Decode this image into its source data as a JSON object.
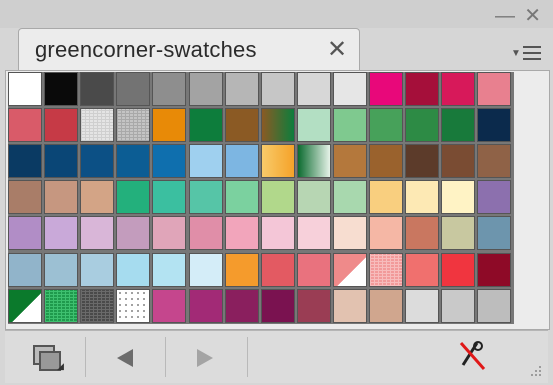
{
  "window": {
    "minimize_icon": "minimize-icon",
    "close_icon": "close-window-icon"
  },
  "tab": {
    "label": "greencorner-swatches",
    "close_glyph": "✕"
  },
  "panel_menu_icon": "panel-menu-icon",
  "swatches": [
    [
      "#ffffff",
      "#0a0a0a",
      "#4a4a4a",
      "#737373",
      "#8e8e8e",
      "#a3a3a3",
      "#b6b6b6",
      "#c6c6c6",
      "#d7d7d7",
      "#e6e6e6",
      "#e8087a",
      "#a50f3a",
      "#d7195a",
      "#e8808f"
    ],
    [
      "#d95b69",
      "#c63a46",
      "pattern:noise-light",
      "pattern:noise-grey",
      "#e88a07",
      "#0d7d3c",
      "#8b5a24",
      "gradient:#8b5a24-#0d7d3c",
      "#b3dfc3",
      "#7fc98f",
      "#47a15a",
      "#2d8b45",
      "#187a3b",
      "#0b2a4c"
    ],
    [
      "#0a3a63",
      "#0a4676",
      "#0c5085",
      "#0c5d94",
      "#0f6fae",
      "#9fd0ef",
      "#7db6e2",
      "gradient:#f8cb6a-#f5a229",
      "gradient:#0c6b30-#e6f2e8",
      "#b4783c",
      "#9a622d",
      "#5c3b2a",
      "#7a4c33",
      "#8f6247"
    ],
    [
      "#a97d68",
      "#c69780",
      "#d3a486",
      "#23b07c",
      "#3bbfa0",
      "#56c5a7",
      "#7bd19f",
      "#b1d88b",
      "#b7d6b3",
      "#a8d8ae",
      "#f9cf7f",
      "#fde9b4",
      "#fff3c5",
      "#8c70ae"
    ],
    [
      "#b18dc6",
      "#c9a9d9",
      "#d9b6d8",
      "#c39cbd",
      "#e0a5b9",
      "#e08ea8",
      "#f2a5bb",
      "#f4c6d7",
      "#f7d0da",
      "#f7ddd0",
      "#f5b7a5",
      "#c97760",
      "#c8c8a0",
      "#6d95ad"
    ],
    [
      "#91b4ca",
      "#9cc0d3",
      "#a9cde0",
      "#a6dcef",
      "#b3e3f2",
      "#d4edf8",
      "#f59b2c",
      "#e35a62",
      "#e9727e",
      "split:#ef8a8a",
      "pattern:noise-pink",
      "#f0706e",
      "#f0353f",
      "#8d1010"
    ],
    [
      "split:#0b7a2c",
      "pattern:noise-green",
      "pattern:noise-dark",
      "pattern:dots",
      "#c5468d",
      "#a22a76",
      "#8a1f5e",
      "#7a1250",
      "#9a3d54",
      "#e2c2b0",
      "#d0a68e",
      "#dcdcdc",
      "#c9c9c9",
      "#bdbdbd"
    ]
  ],
  "extra_swatch": "#8e0a27",
  "bottom": {
    "library_icon": "swatch-libraries-icon",
    "prev_icon": "previous-library-icon",
    "next_icon": "next-library-icon",
    "delete_icon": "delete-swatch-icon",
    "grip_icon": "resize-grip-icon"
  }
}
